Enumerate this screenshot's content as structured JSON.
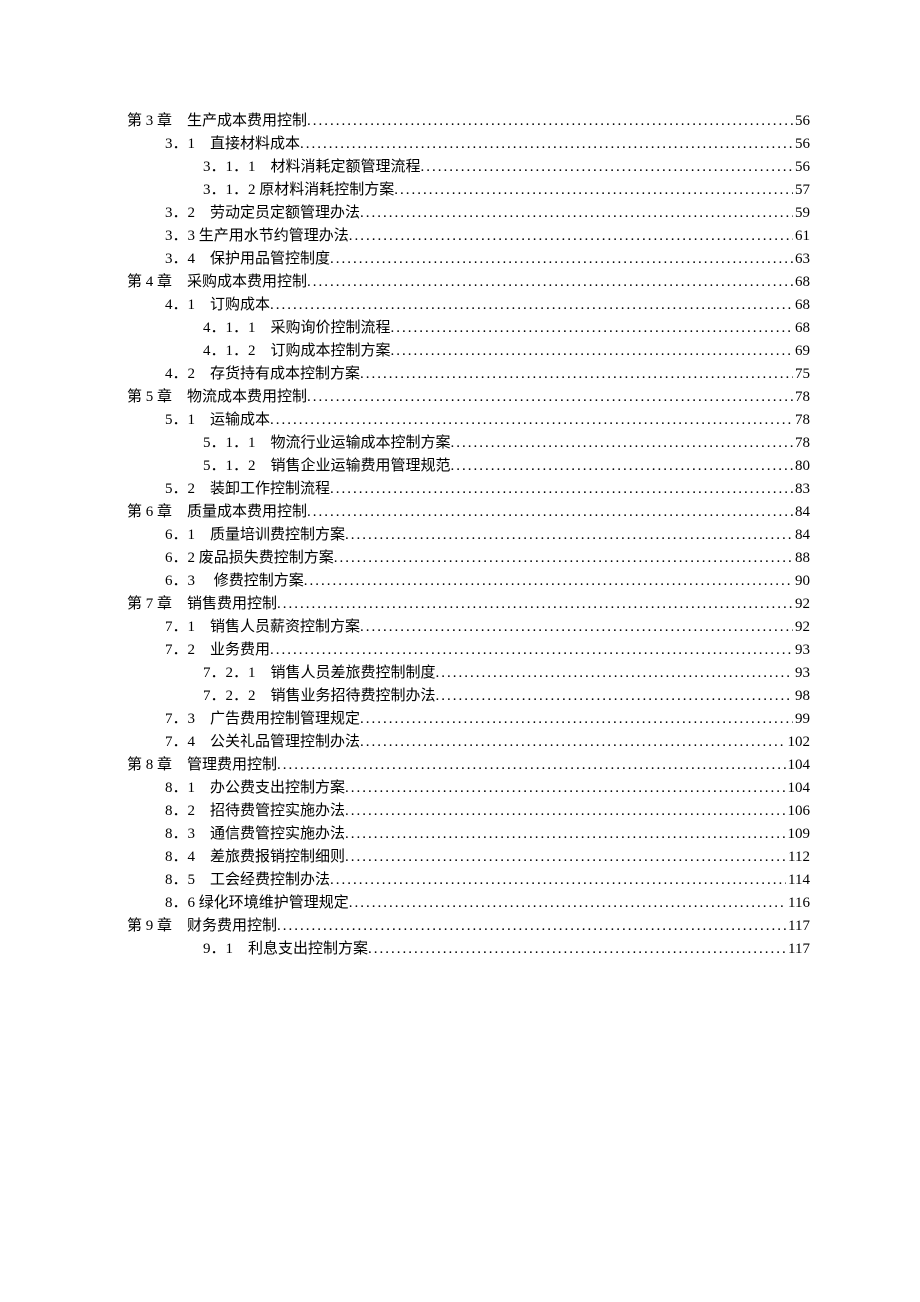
{
  "toc": [
    {
      "level": 0,
      "label": "第 3 章　生产成本费用控制",
      "page": "56"
    },
    {
      "level": 1,
      "label": "3．1　直接材料成本",
      "page": "56"
    },
    {
      "level": 2,
      "label": "3．1．1　材料消耗定额管理流程",
      "page": "56"
    },
    {
      "level": 2,
      "label": "3．1．2  原材料消耗控制方案",
      "page": "57"
    },
    {
      "level": 1,
      "label": "3．2　劳动定员定额管理办法",
      "page": "59"
    },
    {
      "level": 1,
      "label": "3．3  生产用水节约管理办法",
      "page": "61"
    },
    {
      "level": 1,
      "label": "3．4　保护用品管控制度",
      "page": "63"
    },
    {
      "level": 0,
      "label": "第 4 章　采购成本费用控制",
      "page": "68"
    },
    {
      "level": 1,
      "label": "4．1　订购成本",
      "page": "68"
    },
    {
      "level": 2,
      "label": "4．1．1　采购询价控制流程",
      "page": "68"
    },
    {
      "level": 2,
      "label": "4．1．2　订购成本控制方案",
      "page": "69"
    },
    {
      "level": 1,
      "label": "4．2　存货持有成本控制方案",
      "page": "75"
    },
    {
      "level": 0,
      "label": "第 5 章　物流成本费用控制",
      "page": "78"
    },
    {
      "level": 1,
      "label": "5．1　运输成本",
      "page": "78"
    },
    {
      "level": 2,
      "label": "5．1．1　物流行业运输成本控制方案",
      "page": "78"
    },
    {
      "level": 2,
      "label": "5．1．2　销售企业运输费用管理规范",
      "page": "80"
    },
    {
      "level": 1,
      "label": "5．2　装卸工作控制流程",
      "page": "83"
    },
    {
      "level": 0,
      "label": "第 6 章　质量成本费用控制",
      "page": "84"
    },
    {
      "level": 1,
      "label": "6．1　质量培训费控制方案",
      "page": "84"
    },
    {
      "level": 1,
      "label": "6．2  废品损失费控制方案",
      "page": "88"
    },
    {
      "level": 1,
      "label": "6．3　 修费控制方案",
      "page": "90"
    },
    {
      "level": 0,
      "label": "第 7 章　销售费用控制",
      "page": "92"
    },
    {
      "level": 1,
      "label": "7．1　销售人员薪资控制方案",
      "page": "92"
    },
    {
      "level": 1,
      "label": "7．2　业务费用",
      "page": "93"
    },
    {
      "level": 2,
      "label": "7．2．1　销售人员差旅费控制制度",
      "page": "93"
    },
    {
      "level": 2,
      "label": "7．2．2　销售业务招待费控制办法",
      "page": "98"
    },
    {
      "level": 1,
      "label": "7．3　广告费用控制管理规定",
      "page": "99"
    },
    {
      "level": 1,
      "label": "7．4　公关礼品管理控制办法",
      "page": "102"
    },
    {
      "level": 0,
      "label": "第 8 章　管理费用控制",
      "page": "104"
    },
    {
      "level": 1,
      "label": "8．1　办公费支出控制方案",
      "page": "104"
    },
    {
      "level": 1,
      "label": "8．2　招待费管控实施办法",
      "page": "106"
    },
    {
      "level": 1,
      "label": "8．3　通信费管控实施办法",
      "page": "109"
    },
    {
      "level": 1,
      "label": "8．4　差旅费报销控制细则",
      "page": "112"
    },
    {
      "level": 1,
      "label": "8．5　工会经费控制办法",
      "page": "114"
    },
    {
      "level": 1,
      "label": "8．6  绿化环境维护管理规定",
      "page": "116"
    },
    {
      "level": 0,
      "label": "第 9 章　财务费用控制",
      "page": "117"
    },
    {
      "level": 2,
      "label": "9．1　利息支出控制方案",
      "page": "117"
    }
  ]
}
